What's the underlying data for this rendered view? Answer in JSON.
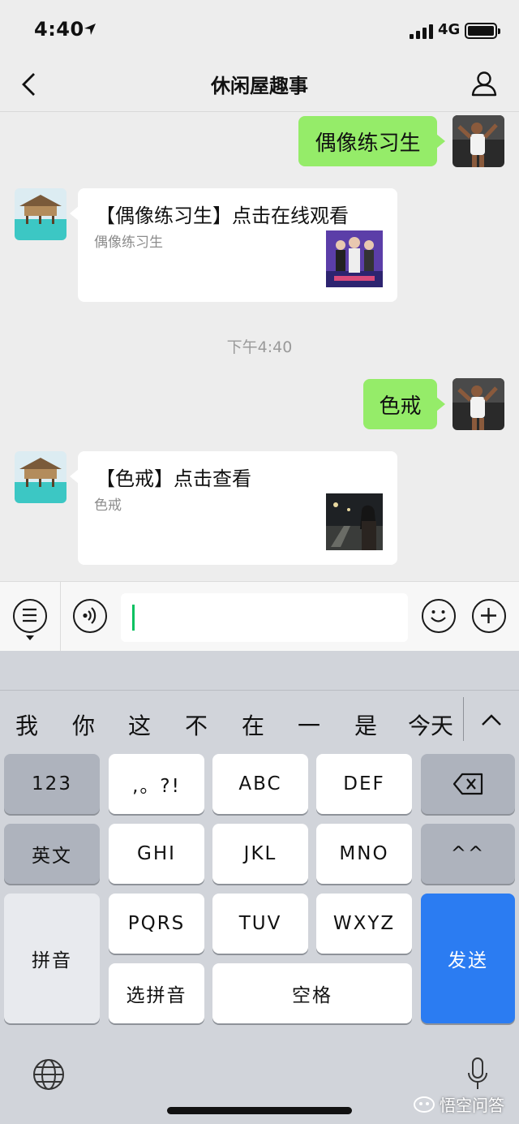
{
  "status": {
    "time": "4:40",
    "network": "4G"
  },
  "nav": {
    "title": "休闲屋趣事"
  },
  "messages": {
    "m1": {
      "text": "偶像练习生"
    },
    "m2": {
      "title": "【偶像练习生】点击在线观看",
      "subtitle": "偶像练习生"
    },
    "timestamp": "下午4:40",
    "m3": {
      "text": "色戒"
    },
    "m4": {
      "title": "【色戒】点击查看",
      "subtitle": "色戒"
    }
  },
  "keyboard": {
    "candidates": [
      "我",
      "你",
      "这",
      "不",
      "在",
      "一",
      "是",
      "今天"
    ],
    "keys": {
      "num": "123",
      "punct": ",。?!",
      "abc": "ABC",
      "def": "DEF",
      "english": "英文",
      "ghi": "GHI",
      "jkl": "JKL",
      "mno": "MNO",
      "emoticon": "^^",
      "pinyin": "拼音",
      "pqrs": "PQRS",
      "tuv": "TUV",
      "wxyz": "WXYZ",
      "send": "发送",
      "select_pinyin": "选拼音",
      "space": "空格"
    }
  },
  "watermark": "悟空问答",
  "colors": {
    "bubble": "#95ec69",
    "send": "#2b7cf2",
    "caret": "#07c160"
  }
}
